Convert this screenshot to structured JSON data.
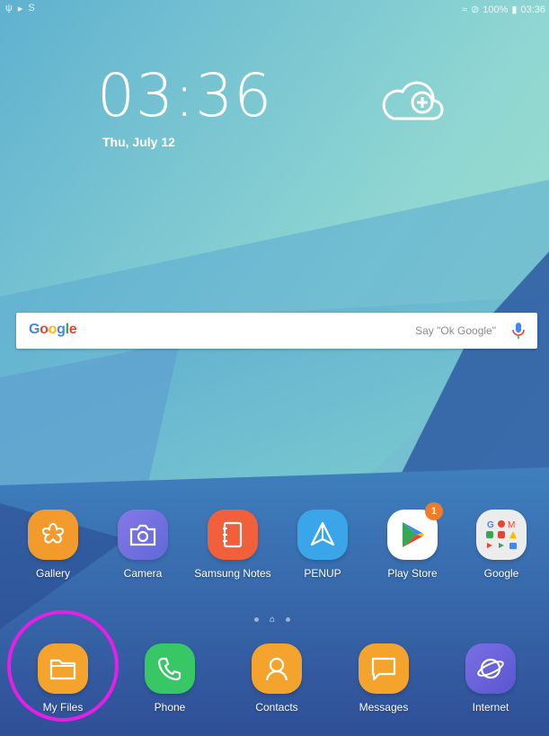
{
  "status": {
    "battery": "100%",
    "time": "03:36"
  },
  "lockscreen": {
    "clock": "03:36",
    "date": "Thu, July 12"
  },
  "search": {
    "logo": "Google",
    "hint": "Say \"Ok Google\""
  },
  "apps": [
    {
      "label": "Gallery",
      "icon": "gallery-icon",
      "color": "#f39a2c"
    },
    {
      "label": "Camera",
      "icon": "camera-icon",
      "color": "#7b6fe0"
    },
    {
      "label": "Samsung Notes",
      "icon": "notes-icon",
      "color": "#f2603b"
    },
    {
      "label": "PENUP",
      "icon": "penup-icon",
      "color": "#3aa5e8"
    },
    {
      "label": "Play Store",
      "icon": "play-store-icon",
      "color": "#ffffff",
      "badge": "1"
    },
    {
      "label": "Google",
      "icon": "google-folder-icon",
      "color": "#ececec"
    }
  ],
  "dock": [
    {
      "label": "My Files",
      "icon": "folder-icon",
      "color": "#f4a32d"
    },
    {
      "label": "Phone",
      "icon": "phone-icon",
      "color": "#37c764"
    },
    {
      "label": "Contacts",
      "icon": "contacts-icon",
      "color": "#f4a32d"
    },
    {
      "label": "Messages",
      "icon": "messages-icon",
      "color": "#f4a32d"
    },
    {
      "label": "Internet",
      "icon": "internet-icon",
      "color": "#6b63d9"
    }
  ],
  "highlight_color": "#e61ee6"
}
